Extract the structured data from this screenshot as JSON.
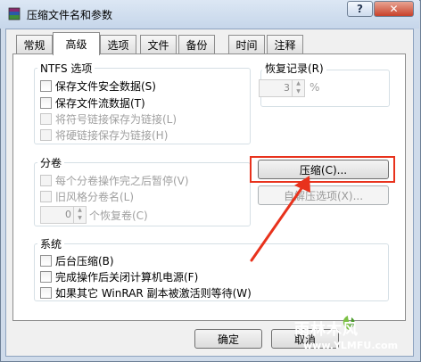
{
  "window": {
    "title": "压缩文件名和参数",
    "help_label": "?",
    "close_label": "✕"
  },
  "tabs": [
    {
      "label": "常规"
    },
    {
      "label": "高级",
      "active": true
    },
    {
      "label": "选项"
    },
    {
      "label": "文件"
    },
    {
      "label": "备份"
    },
    {
      "label": "时间"
    },
    {
      "label": "注释"
    }
  ],
  "ntfs": {
    "title": "NTFS 选项",
    "options": [
      {
        "label": "保存文件安全数据(S)",
        "checked": false,
        "enabled": true
      },
      {
        "label": "保存文件流数据(T)",
        "checked": false,
        "enabled": true
      },
      {
        "label": "将符号链接保存为链接(L)",
        "checked": false,
        "enabled": false
      },
      {
        "label": "将硬链接保存为链接(H)",
        "checked": false,
        "enabled": false
      }
    ]
  },
  "recovery": {
    "title": "恢复记录(R)",
    "value": "3",
    "unit": "%"
  },
  "volumes": {
    "title": "分卷",
    "options": [
      {
        "label": "每个分卷操作完之后暂停(V)",
        "checked": false,
        "enabled": false
      },
      {
        "label": "旧风格分卷名(L)",
        "checked": false,
        "enabled": false
      }
    ],
    "recovery_volumes_value": "0",
    "recovery_volumes_label": "个恢复卷(C)"
  },
  "buttons": {
    "compression": "压缩(C)...",
    "sfx_options": "自解压选项(X)...",
    "ok": "确定",
    "cancel": "取消"
  },
  "system": {
    "title": "系统",
    "options": [
      {
        "label": "后台压缩(B)",
        "checked": false
      },
      {
        "label": "完成操作后关闭计算机电源(F)",
        "checked": false
      },
      {
        "label": "如果其它 WinRAR 副本被激活则等待(W)",
        "checked": false
      }
    ]
  },
  "annotation": {
    "highlight_color": "#e8321c"
  },
  "watermark": {
    "brand": "雨林木风",
    "url": "www.YLMFU.com"
  }
}
